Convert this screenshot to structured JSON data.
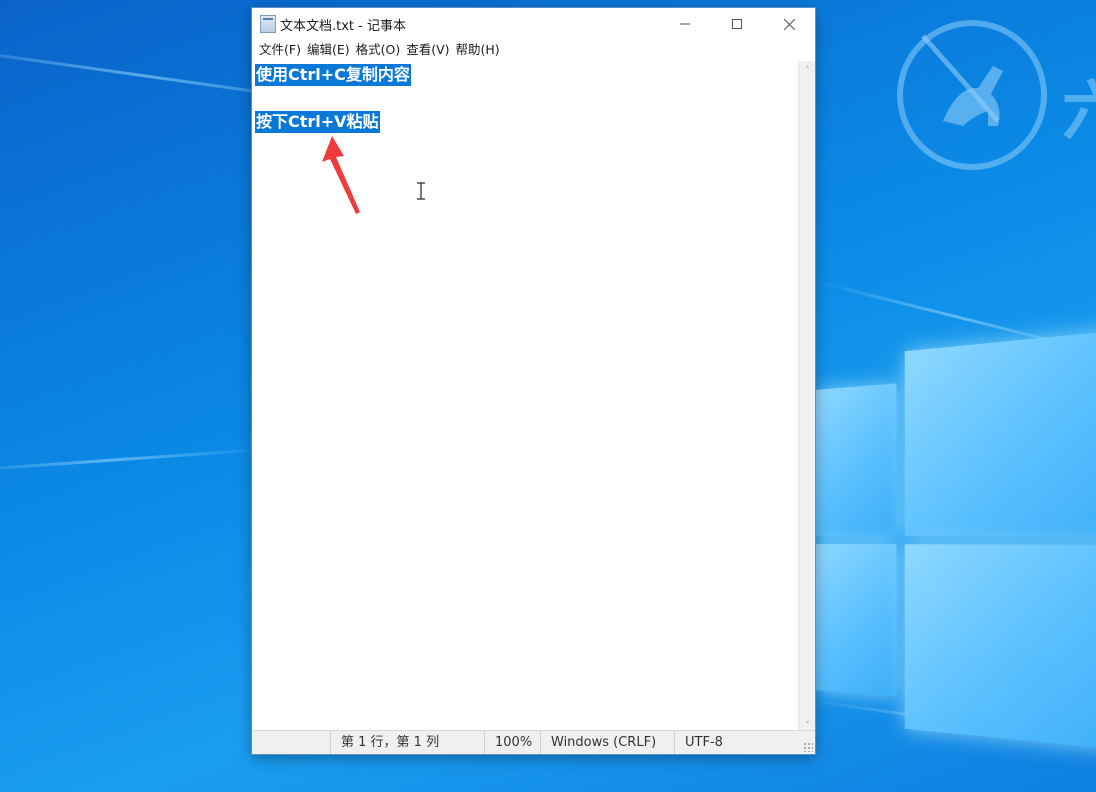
{
  "window": {
    "title": "文本文档.txt - 记事本",
    "minimize_icon": "minimize-icon",
    "maximize_icon": "maximize-icon",
    "close_icon": "close-icon"
  },
  "menu": {
    "items": [
      {
        "label": "文件(F)"
      },
      {
        "label": "编辑(E)"
      },
      {
        "label": "格式(O)"
      },
      {
        "label": "查看(V)"
      },
      {
        "label": "帮助(H)"
      }
    ]
  },
  "editor": {
    "lines": [
      {
        "text": "使用Ctrl+C复制内容",
        "selected": true
      },
      {
        "text": "",
        "selected": false
      },
      {
        "text": "按下Ctrl+V粘贴",
        "selected": true
      }
    ]
  },
  "statusbar": {
    "position": "第 1 行，第 1 列",
    "zoom": "100%",
    "line_ending": "Windows (CRLF)",
    "encoding": "UTF-8"
  },
  "colors": {
    "selection": "#0a78d7",
    "annotation_arrow": "#ef3b3b",
    "desktop": "#0b8ae6"
  }
}
